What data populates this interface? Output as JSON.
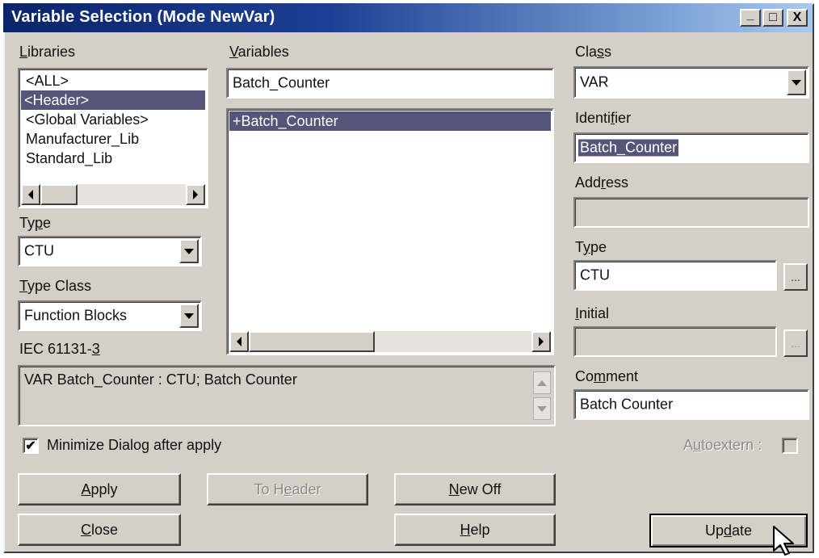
{
  "window": {
    "title": "Variable Selection (Mode NewVar)",
    "controls": {
      "minimize": "_",
      "maximize": "□",
      "close": "X"
    }
  },
  "libraries": {
    "label_pre": "",
    "label_key": "L",
    "label_post": "ibraries",
    "items": [
      "<ALL>",
      "<Header>",
      "<Global Variables>",
      "Manufacturer_Lib",
      "Standard_Lib"
    ],
    "selected_index": 1
  },
  "type_left": {
    "label_pre": "Ty",
    "label_key": "p",
    "label_post": "e",
    "value": "CTU"
  },
  "type_class": {
    "label_pre": "",
    "label_key": "T",
    "label_post": "ype Class",
    "value": "Function Blocks"
  },
  "standard": {
    "label_pre": "IEC 61131-",
    "label_key": "3",
    "label_post": ""
  },
  "declaration": {
    "text": "VAR Batch_Counter : CTU; Batch Counter"
  },
  "variables": {
    "label_pre": "",
    "label_key": "V",
    "label_post": "ariables",
    "filter_value": "Batch_Counter",
    "items": [
      "+Batch_Counter"
    ],
    "selected_index": 0
  },
  "class": {
    "label_pre": "Cla",
    "label_key": "s",
    "label_post": "s",
    "value": "VAR"
  },
  "identifier": {
    "label_pre": "Identi",
    "label_key": "f",
    "label_post": "ier",
    "value": "Batch_Counter"
  },
  "address": {
    "label_pre": "Add",
    "label_key": "r",
    "label_post": "ess",
    "value": ""
  },
  "type_right": {
    "label_pre": "T",
    "label_key": "y",
    "label_post": "pe",
    "value": "CTU",
    "browse": "..."
  },
  "initial": {
    "label_pre": "",
    "label_key": "I",
    "label_post": "nitial",
    "value": "",
    "browse": "..."
  },
  "comment": {
    "label_pre": "Co",
    "label_key": "m",
    "label_post": "ment",
    "value": "Batch Counter"
  },
  "minimize": {
    "checked_mark": "✔",
    "label": "Minimize  Dialog after apply"
  },
  "autoextern": {
    "label_pre": "A",
    "label_key": "u",
    "label_post": "toextern :"
  },
  "buttons": {
    "apply": {
      "pre": "",
      "key": "A",
      "post": "pply"
    },
    "to_header": {
      "pre": "To H",
      "key": "e",
      "post": "ader"
    },
    "new_off": {
      "pre": "",
      "key": "N",
      "post": "ew Off"
    },
    "close": {
      "pre": "",
      "key": "C",
      "post": "lose"
    },
    "help": {
      "pre": "",
      "key": "H",
      "post": "elp"
    },
    "update": {
      "pre": "Up",
      "key": "d",
      "post": "ate"
    }
  }
}
